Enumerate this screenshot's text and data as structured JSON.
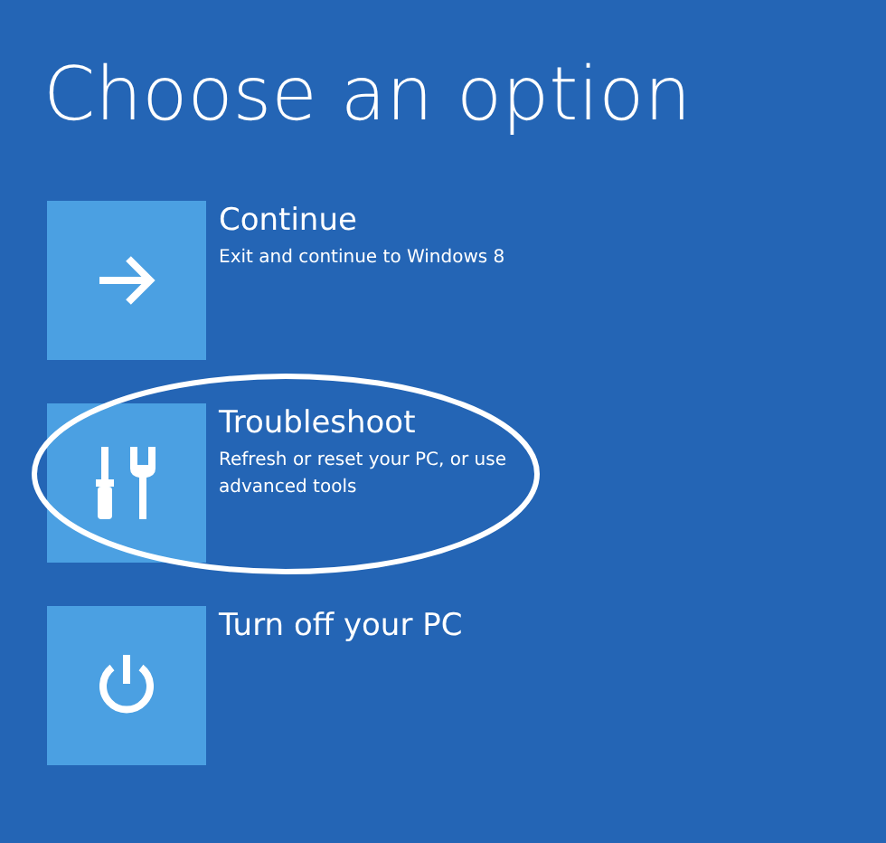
{
  "title": "Choose an option",
  "options": [
    {
      "kind": "arrow",
      "label": "Continue",
      "description": "Exit and continue to Windows 8",
      "highlighted": false
    },
    {
      "kind": "tools",
      "label": "Troubleshoot",
      "description": "Refresh or reset your PC, or use advanced tools",
      "highlighted": true
    },
    {
      "kind": "power",
      "label": "Turn off your PC",
      "highlighted": false
    }
  ]
}
